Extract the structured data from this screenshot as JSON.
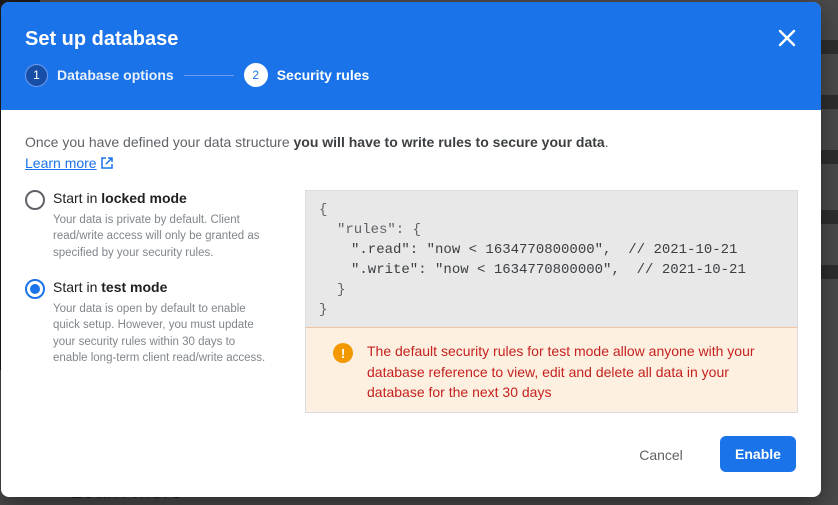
{
  "dialog": {
    "title": "Set up database",
    "steps": [
      {
        "number": "1",
        "label": "Database options"
      },
      {
        "number": "2",
        "label": "Security rules"
      }
    ],
    "intro_plain": "Once you have defined your data structure ",
    "intro_bold": "you will have to write rules to secure your data",
    "intro_end": ".",
    "learn_more": "Learn more",
    "options": [
      {
        "prefix": "Start in ",
        "mode": "locked mode",
        "description": "Your data is private by default. Client read/write access will only be granted as specified by your security rules.",
        "selected": false
      },
      {
        "prefix": "Start in ",
        "mode": "test mode",
        "description": "Your data is open by default to enable quick setup. However, you must update your security rules within 30 days to enable long-term client read/write access.",
        "selected": true
      }
    ],
    "code": {
      "open_brace": "{",
      "rules_line": "\"rules\": {",
      "read_line": "\".read\": \"now < 1634770800000\",  // 2021-10-21",
      "write_line": "\".write\": \"now < 1634770800000\",  // 2021-10-21",
      "inner_close": "}",
      "close_brace": "}"
    },
    "warning": {
      "icon": "!",
      "text": "The default security rules for test mode allow anyone with your database reference to view, edit and delete all data in your database for the next 30 days"
    },
    "buttons": {
      "cancel": "Cancel",
      "enable": "Enable"
    }
  },
  "background": {
    "learn_more": "Learn more"
  },
  "colors": {
    "header": "#1a73e8",
    "warning_bg": "#fef0e0",
    "warning_text": "#c5221f",
    "warning_icon": "#f29900"
  }
}
